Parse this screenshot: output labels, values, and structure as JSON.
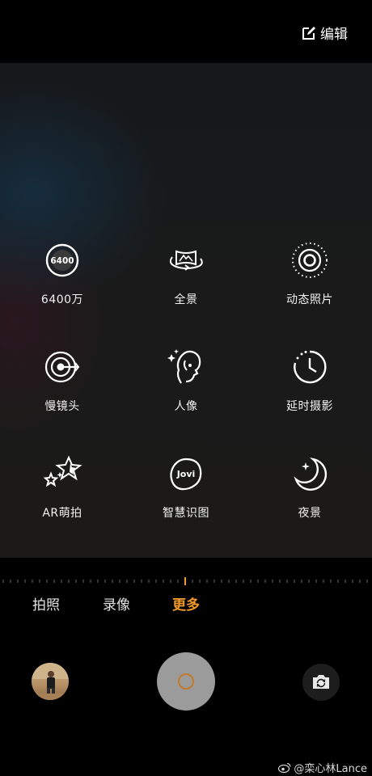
{
  "header": {
    "edit_label": "编辑"
  },
  "modes": [
    {
      "label": "6400万",
      "icon": "64mp-icon"
    },
    {
      "label": "全景",
      "icon": "panorama-icon"
    },
    {
      "label": "动态照片",
      "icon": "live-photo-icon"
    },
    {
      "label": "慢镜头",
      "icon": "slow-motion-icon"
    },
    {
      "label": "人像",
      "icon": "portrait-icon"
    },
    {
      "label": "延时摄影",
      "icon": "timelapse-icon"
    },
    {
      "label": "AR萌拍",
      "icon": "ar-stickers-icon"
    },
    {
      "label": "智慧识图",
      "icon": "jovi-vision-icon"
    },
    {
      "label": "夜景",
      "icon": "night-mode-icon"
    }
  ],
  "icon_text": {
    "mp": "6400",
    "jovi": "Jovi"
  },
  "tabs": [
    {
      "label": "拍照",
      "active": false
    },
    {
      "label": "录像",
      "active": false
    },
    {
      "label": "更多",
      "active": true
    }
  ],
  "colors": {
    "accent": "#f39a2b",
    "shutter": "#9b9b9b"
  },
  "watermark": {
    "text": "@栾心林Lance"
  }
}
